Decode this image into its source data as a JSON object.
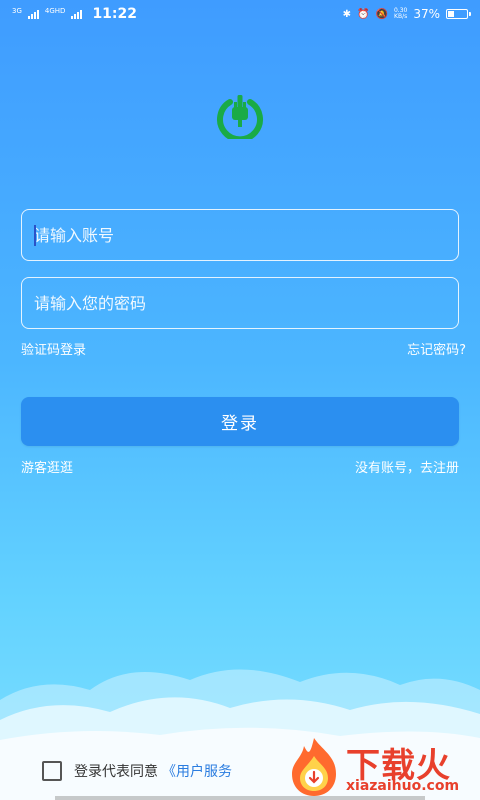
{
  "status_bar": {
    "net1": "3G",
    "net2": "4GHD",
    "time": "11:22",
    "speed_value": "0.30",
    "speed_unit": "KB/s",
    "battery_percent": "37%",
    "battery_level": 0.37
  },
  "form": {
    "account_placeholder": "请输入账号",
    "password_placeholder": "请输入您的密码",
    "sms_login": "验证码登录",
    "forgot_password": "忘记密码?",
    "login_button": "登录",
    "guest": "游客逛逛",
    "register": "没有账号，去注册"
  },
  "agreement": {
    "text": "登录代表同意",
    "link": "《用户服务"
  },
  "watermark": {
    "title": "下载火",
    "site": "xiazaihuo.com"
  },
  "colors": {
    "accent": "#2b8ff0",
    "logo_green": "#1aab46",
    "watermark_red": "#e8402c"
  },
  "icons": [
    "bluetooth-icon",
    "alarm-icon",
    "mute-icon",
    "battery-icon",
    "power-plug-logo-icon",
    "flame-icon"
  ]
}
